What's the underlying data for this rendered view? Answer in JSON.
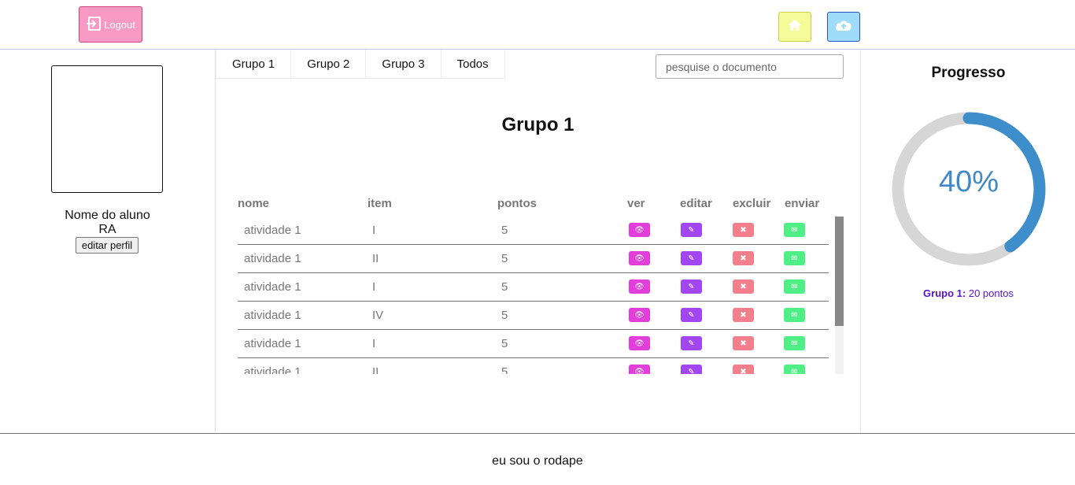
{
  "header": {
    "logout_label": "Logout"
  },
  "profile": {
    "name": "Nome do aluno",
    "ra": "RA",
    "edit_label": "editar perfil"
  },
  "tabs": [
    {
      "label": "Grupo 1"
    },
    {
      "label": "Grupo 2"
    },
    {
      "label": "Grupo 3"
    },
    {
      "label": "Todos"
    }
  ],
  "search": {
    "placeholder": "pesquise o documento",
    "value": ""
  },
  "main": {
    "title": "Grupo 1"
  },
  "table": {
    "columns": [
      "nome",
      "item",
      "pontos",
      "ver",
      "editar",
      "excluir",
      "enviar"
    ],
    "rows": [
      {
        "nome": "atividade 1",
        "item": "I",
        "pontos": "5"
      },
      {
        "nome": "atividade 1",
        "item": "II",
        "pontos": "5"
      },
      {
        "nome": "atividade 1",
        "item": "I",
        "pontos": "5"
      },
      {
        "nome": "atividade 1",
        "item": "IV",
        "pontos": "5"
      },
      {
        "nome": "atividade 1",
        "item": "I",
        "pontos": "5"
      },
      {
        "nome": "atividade 1",
        "item": "II",
        "pontos": "5"
      }
    ],
    "action_icons": {
      "ver": "eye-icon",
      "editar": "pencil-icon",
      "excluir": "x-icon",
      "enviar": "envelope-download-icon"
    }
  },
  "progress": {
    "title": "Progresso",
    "percent_label": "40%",
    "percent_value": 0.4,
    "group_label": "Grupo 1:",
    "group_points": "20 pontos"
  },
  "footer": {
    "text": "eu sou o rodape"
  },
  "colors": {
    "logout_bg": "#f89ac4",
    "home_bg": "#f6fb9a",
    "upload_bg": "#9fdcf9",
    "ver": "#e23fda",
    "editar": "#a246ef",
    "excluir": "#f57e8c",
    "enviar": "#4fef86",
    "gauge_fill": "#3d8ecb",
    "gauge_track": "#d6d6d6"
  }
}
